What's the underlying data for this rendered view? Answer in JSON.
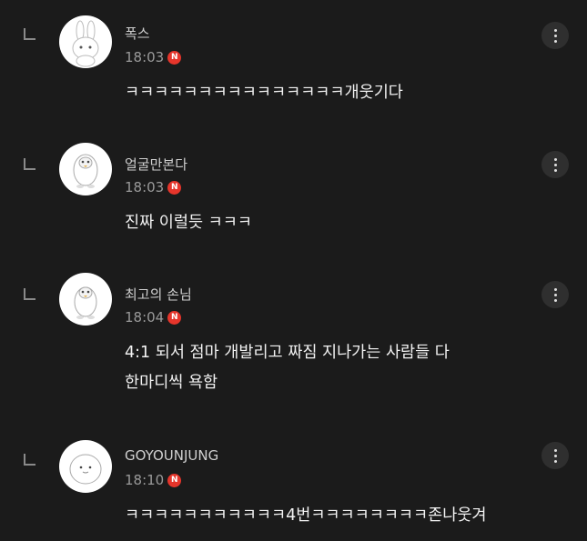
{
  "comments": [
    {
      "author": "폭스",
      "time": "18:03",
      "badge": "N",
      "lines": [
        "ㅋㅋㅋㅋㅋㅋㅋㅋㅋㅋㅋㅋㅋㅋㅋ개웃기다"
      ],
      "avatar_icon": "rabbit-avatar-icon"
    },
    {
      "author": "얼굴만본다",
      "time": "18:03",
      "badge": "N",
      "lines": [
        "진짜 이럴듯 ㅋㅋㅋ"
      ],
      "avatar_icon": "penguin-avatar-icon"
    },
    {
      "author": "최고의 손님",
      "time": "18:04",
      "badge": "N",
      "lines": [
        "4:1 되서 점마 개발리고 짜짐 지나가는 사람들 다",
        "한마디씩 욕함"
      ],
      "avatar_icon": "penguin-avatar-icon"
    },
    {
      "author": "GOYOUNJUNG",
      "time": "18:10",
      "badge": "N",
      "lines": [
        "ㅋㅋㅋㅋㅋㅋㅋㅋㅋㅋㅋ4번ㅋㅋㅋㅋㅋㅋㅋㅋ존나웃겨"
      ],
      "avatar_icon": "blob-avatar-icon"
    }
  ],
  "colors": {
    "background": "#1b1b1b",
    "new_badge": "#e6352b",
    "more_button": "#2f2f2f"
  }
}
